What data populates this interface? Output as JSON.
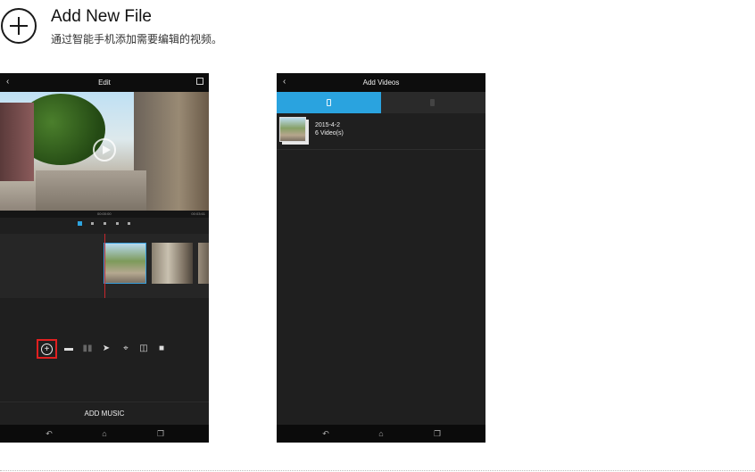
{
  "header": {
    "icon": "add-circle-icon",
    "title": "Add New File",
    "subtitle": "通过智能手机添加需要编辑的视频。"
  },
  "edit_screen": {
    "title": "Edit",
    "time_start": "00:00:00",
    "time_end": "00:03:61",
    "page_dots": 5,
    "active_dot": 0,
    "tools": [
      "add-icon",
      "trim-icon",
      "split-icon",
      "speed-icon",
      "crop-icon",
      "rotate-icon",
      "delete-icon"
    ],
    "add_music_label": "ADD MUSIC"
  },
  "videos_screen": {
    "title": "Add Videos",
    "active_tab": "local",
    "album": {
      "date": "2015-4-2",
      "count": "6 Video(s)"
    }
  },
  "navbar": [
    "back-icon",
    "home-icon",
    "recents-icon"
  ],
  "colors": {
    "accent": "#2aa3df",
    "highlight": "#e02020",
    "phone_bg": "#1f1f1f"
  }
}
